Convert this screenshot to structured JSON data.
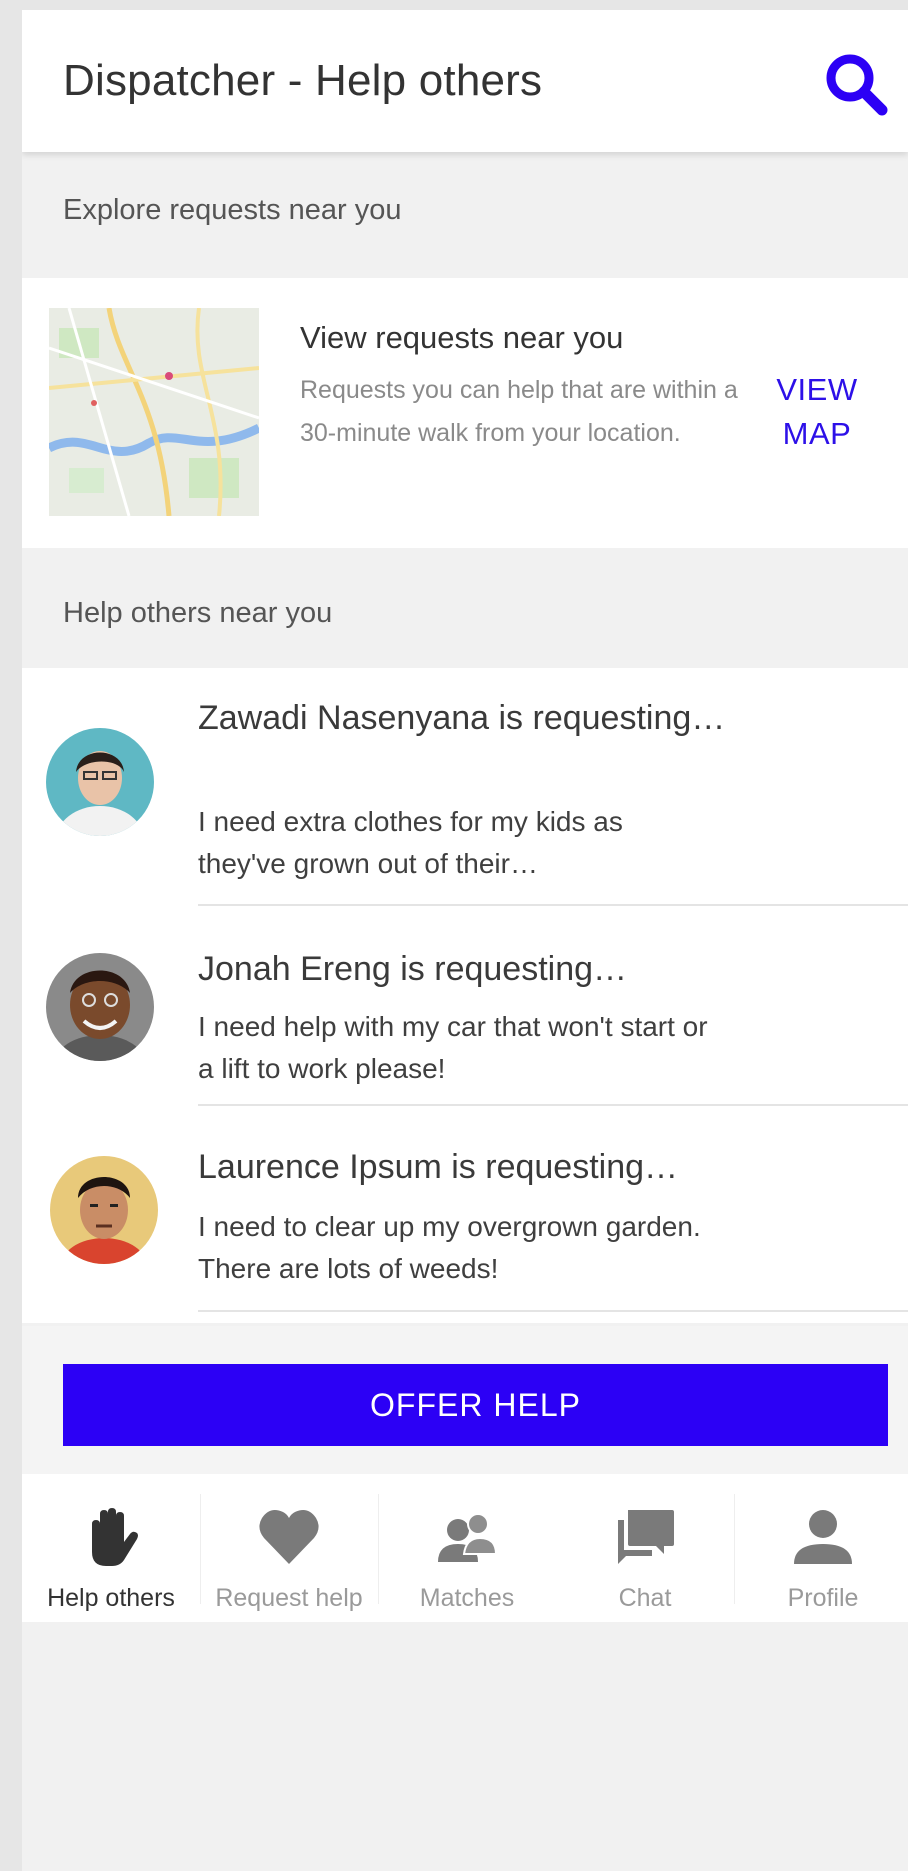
{
  "appbar": {
    "title": "Dispatcher - Help others",
    "search_icon": "search-icon"
  },
  "colors": {
    "accent": "#2c00f5",
    "link": "#2d10e8",
    "background": "#f1f1f1"
  },
  "explore": {
    "header": "Explore requests near you",
    "card_title": "View requests near you",
    "card_desc": "Requests you can help that are within a 30-minute walk from your location.",
    "action_line1": "VIEW",
    "action_line2": "MAP"
  },
  "nearby": {
    "header": "Help others near you",
    "requests": [
      {
        "name": "Zawadi Nasenyana is requesting…",
        "message": "I need extra clothes for my kids as they've grown out of their…"
      },
      {
        "name": "Jonah Ereng is requesting…",
        "message": "I need help with my car that won't start or a lift to work please!"
      },
      {
        "name": "Laurence Ipsum is requesting…",
        "message": "I need to clear up my overgrown garden. There are lots of weeds!"
      }
    ]
  },
  "offer_button": "OFFER HELP",
  "nav": [
    {
      "label": "Help others",
      "icon": "hand-icon",
      "active": true
    },
    {
      "label": "Request help",
      "icon": "heart-icon",
      "active": false
    },
    {
      "label": "Matches",
      "icon": "people-icon",
      "active": false
    },
    {
      "label": "Chat",
      "icon": "chat-icon",
      "active": false
    },
    {
      "label": "Profile",
      "icon": "person-icon",
      "active": false
    }
  ]
}
